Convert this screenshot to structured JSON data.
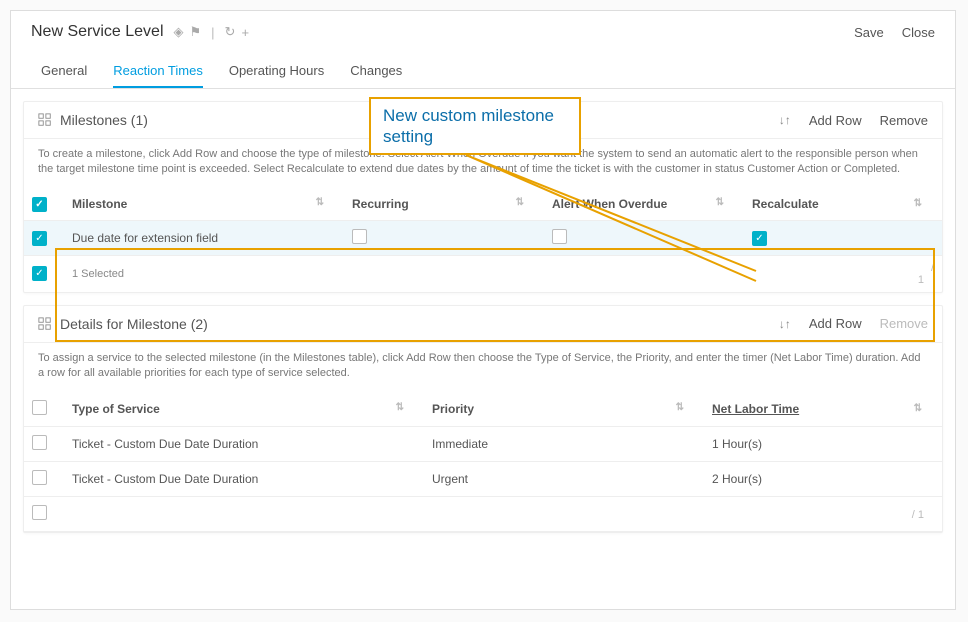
{
  "header": {
    "title": "New Service Level",
    "save_label": "Save",
    "close_label": "Close"
  },
  "tabs": {
    "general": "General",
    "reaction_times": "Reaction Times",
    "operating_hours": "Operating Hours",
    "changes": "Changes"
  },
  "callout": {
    "text": "New custom milestone setting"
  },
  "milestones": {
    "title": "Milestones  (1)",
    "add_row": "Add Row",
    "remove": "Remove",
    "help": "To create a milestone, click Add Row and choose the type of milestone. Select Alert When Overdue if you want the system to send an automatic alert to the responsible person when the target milestone time point is exceeded. Select Recalculate to extend due dates by the amount of time the ticket is with the customer in status Customer Action or Completed.",
    "cols": {
      "milestone": "Milestone",
      "recurring": "Recurring",
      "alert": "Alert When Overdue",
      "recalculate": "Recalculate"
    },
    "rows": [
      {
        "selected": true,
        "milestone": "Due date for extension field",
        "recurring": false,
        "alert": false,
        "recalculate": true
      }
    ],
    "footer": "1 Selected",
    "pager": "/ 1"
  },
  "details": {
    "title": "Details for Milestone  (2)",
    "add_row": "Add Row",
    "remove": "Remove",
    "help": "To assign a service to the selected milestone (in the Milestones table), click Add Row then choose the Type of Service, the Priority, and enter the timer (Net Labor Time) duration. Add a row for all available priorities for each type of service selected.",
    "cols": {
      "type": "Type of Service",
      "priority": "Priority",
      "time": "Net Labor Time"
    },
    "rows": [
      {
        "selected": false,
        "type": "Ticket - Custom Due Date Duration",
        "priority": "Immediate",
        "time": "1 Hour(s)"
      },
      {
        "selected": false,
        "type": "Ticket - Custom Due Date Duration",
        "priority": "Urgent",
        "time": "2 Hour(s)"
      }
    ],
    "pager": "/ 1"
  }
}
